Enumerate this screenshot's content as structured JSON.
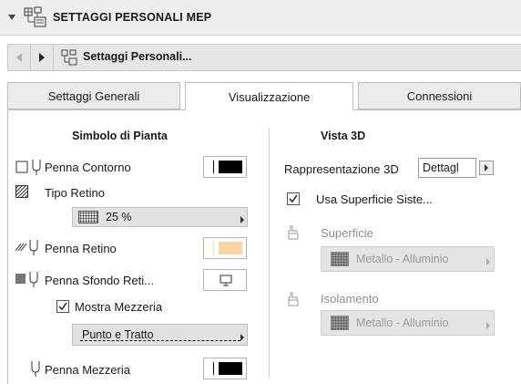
{
  "header": {
    "title": "SETTAGGI PERSONALI MEP"
  },
  "nav": {
    "label": "Settaggi Personali..."
  },
  "tabs": [
    {
      "label": "Settaggi Generali"
    },
    {
      "label": "Visualizzazione"
    },
    {
      "label": "Connessioni"
    }
  ],
  "left": {
    "section_title": "Simbolo di Pianta",
    "penna_contorno": "Penna Contorno",
    "tipo_retino": "Tipo Retino",
    "retino_value": "25 %",
    "penna_retino": "Penna Retino",
    "penna_sfondo": "Penna Sfondo Reti...",
    "mostra_mezzeria": "Mostra Mezzeria",
    "mezzeria_value": "Punto e Tratto",
    "penna_mezzeria": "Penna Mezzeria"
  },
  "right": {
    "section_title": "Vista 3D",
    "rappresentazione": "Rappresentazione 3D",
    "rappresentazione_value": "Dettagl",
    "usa_superficie": "Usa Superficie Siste...",
    "superficie": "Superficie",
    "superficie_value": "Metallo - Alluminio",
    "isolamento": "Isolamento",
    "isolamento_value": "Metallo - Alluminio"
  },
  "colors": {
    "pen_black": "#000000",
    "pen_peach": "#ffd3a8",
    "accent": "#333333"
  }
}
